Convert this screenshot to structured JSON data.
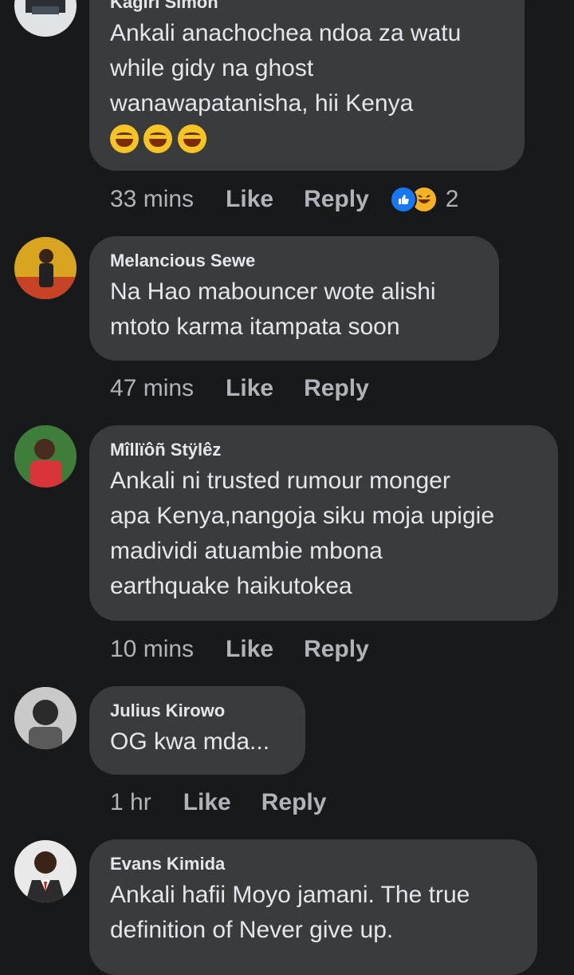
{
  "comments": [
    {
      "author": "Kagiri Simon",
      "text_lines": [
        "Ankali anachochea ndoa za watu",
        "while gidy na ghost",
        "wanawapatanisha, hii Kenya"
      ],
      "emojis": [
        "rolling-on-floor-laughing",
        "rolling-on-floor-laughing",
        "rolling-on-floor-laughing"
      ],
      "time": "33 mins",
      "like_label": "Like",
      "reply_label": "Reply",
      "reaction_count": "2",
      "reactions": [
        "like-icon",
        "haha-icon"
      ]
    },
    {
      "author": "Melancious Sewe",
      "text_lines": [
        "Na Hao mabouncer wote alishi",
        "mtoto karma itampata soon"
      ],
      "time": "47 mins",
      "like_label": "Like",
      "reply_label": "Reply"
    },
    {
      "author": "Mîllïôñ Stÿlêz",
      "text_lines": [
        "Ankali ni trusted rumour monger",
        "apa Kenya,nangoja siku moja upigie",
        "madividi atuambie mbona",
        "earthquake haikutokea"
      ],
      "time": "10 mins",
      "like_label": "Like",
      "reply_label": "Reply"
    },
    {
      "author": "Julius Kirowo",
      "text_lines": [
        "OG kwa mda..."
      ],
      "time": "1 hr",
      "like_label": "Like",
      "reply_label": "Reply"
    },
    {
      "author": "Evans Kimida",
      "text_lines": [
        "Ankali hafii Moyo jamani. The true",
        "definition of Never give up."
      ]
    }
  ],
  "colors": {
    "background": "#18191a",
    "bubble": "#3a3b3c",
    "text": "#e4e6eb",
    "secondary_text": "#b0b3b8",
    "like_blue": "#1877f2",
    "haha_yellow": "#f7b125"
  }
}
